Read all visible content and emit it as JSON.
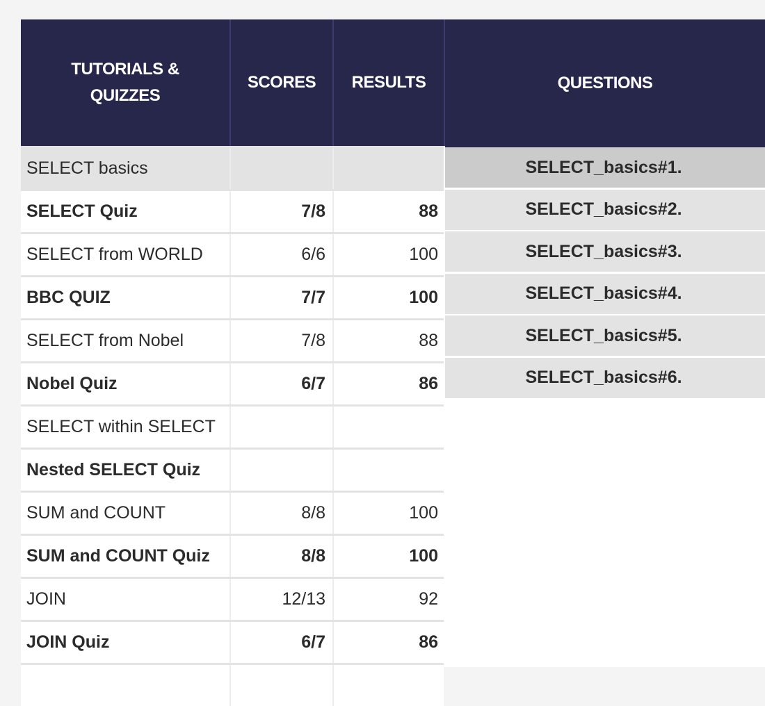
{
  "table": {
    "headers": {
      "tutorials": "TUTORIALS & QUIZZES",
      "scores": "SCORES",
      "results": "RESULTS",
      "questions": "QUESTIONS"
    },
    "rows": [
      {
        "name": "SELECT basics",
        "score": "",
        "result": "",
        "bold": false,
        "shaded": true
      },
      {
        "name": "SELECT Quiz",
        "score": "7/8",
        "result": "88",
        "bold": true,
        "shaded": false
      },
      {
        "name": "SELECT from WORLD",
        "score": "6/6",
        "result": "100",
        "bold": false,
        "shaded": false
      },
      {
        "name": "BBC QUIZ",
        "score": "7/7",
        "result": "100",
        "bold": true,
        "shaded": false
      },
      {
        "name": "SELECT from Nobel",
        "score": "7/8",
        "result": "88",
        "bold": false,
        "shaded": false
      },
      {
        "name": "Nobel Quiz",
        "score": "6/7",
        "result": "86",
        "bold": true,
        "shaded": false
      },
      {
        "name": "SELECT within SELECT",
        "score": "",
        "result": "",
        "bold": false,
        "shaded": false
      },
      {
        "name": "Nested SELECT Quiz",
        "score": "",
        "result": "",
        "bold": true,
        "shaded": false
      },
      {
        "name": "SUM and COUNT",
        "score": "8/8",
        "result": "100",
        "bold": false,
        "shaded": false
      },
      {
        "name": "SUM and COUNT Quiz",
        "score": "8/8",
        "result": "100",
        "bold": true,
        "shaded": false
      },
      {
        "name": "JOIN",
        "score": "12/13",
        "result": "92",
        "bold": false,
        "shaded": false
      },
      {
        "name": "JOIN Quiz",
        "score": "6/7",
        "result": "86",
        "bold": true,
        "shaded": false
      },
      {
        "name": "",
        "score": "",
        "result": "",
        "bold": false,
        "shaded": false
      }
    ],
    "questions": [
      {
        "label": "SELECT_basics#1.",
        "active": true
      },
      {
        "label": "SELECT_basics#2.",
        "active": false
      },
      {
        "label": "SELECT_basics#3.",
        "active": false
      },
      {
        "label": "SELECT_basics#4.",
        "active": false
      },
      {
        "label": "SELECT_basics#5.",
        "active": false
      },
      {
        "label": "SELECT_basics#6.",
        "active": false
      }
    ]
  },
  "colors": {
    "header_bg": "#27264b",
    "row_shaded": "#e3e3e3",
    "question_active": "#cbcbcb"
  }
}
